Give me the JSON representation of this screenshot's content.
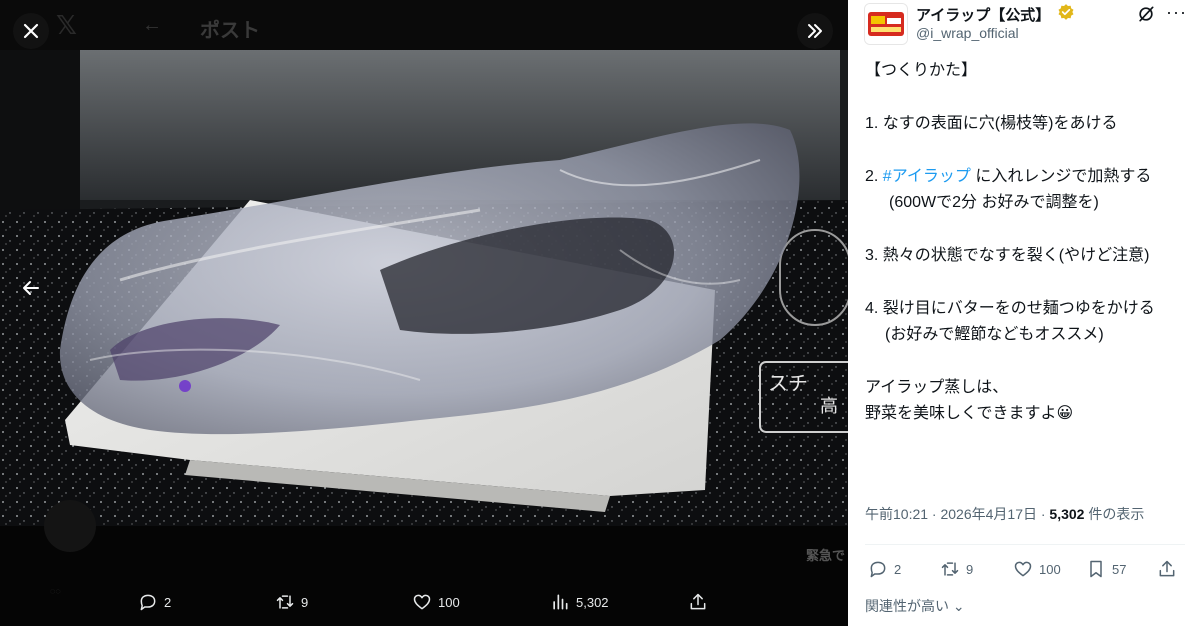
{
  "viewer": {
    "bg_title": "ポスト",
    "bg_ghost_text": "緊急で",
    "stats": {
      "replies": "2",
      "reposts": "9",
      "likes": "100",
      "views": "5,302"
    }
  },
  "tweet": {
    "display_name": "アイラップ【公式】",
    "handle": "@i_wrap_official",
    "lines": {
      "heading": "【つくりかた】",
      "step1": "1.  なすの表面に穴(楊枝等)をあける",
      "step2_prefix": "2. ",
      "step2_hashtag": "#アイラップ",
      "step2_rest": " に入れレンジで加熱する",
      "step2_note": "(600Wで2分 お好みで調整を)",
      "step3": "3. 熱々の状態でなすを裂く(やけど注意)",
      "step4": "4. 裂け目にバターをのせ麺つゆをかける",
      "step4_note": "(お好みで鰹節などもオススメ)",
      "closing1": "アイラップ蒸しは、",
      "closing2": "野菜を美味しくできますよ😀"
    },
    "meta": {
      "time": "午前10:21 · 2026年4月17日 · ",
      "views": "5,302",
      "views_suffix": " 件の表示"
    },
    "actions": {
      "replies": "2",
      "reposts": "9",
      "likes": "100",
      "bookmarks": "57"
    },
    "sort_label": "関連性が高い"
  },
  "colors": {
    "accent": "#1d9bf0",
    "verified": "#e2b719",
    "muted": "#536471"
  }
}
